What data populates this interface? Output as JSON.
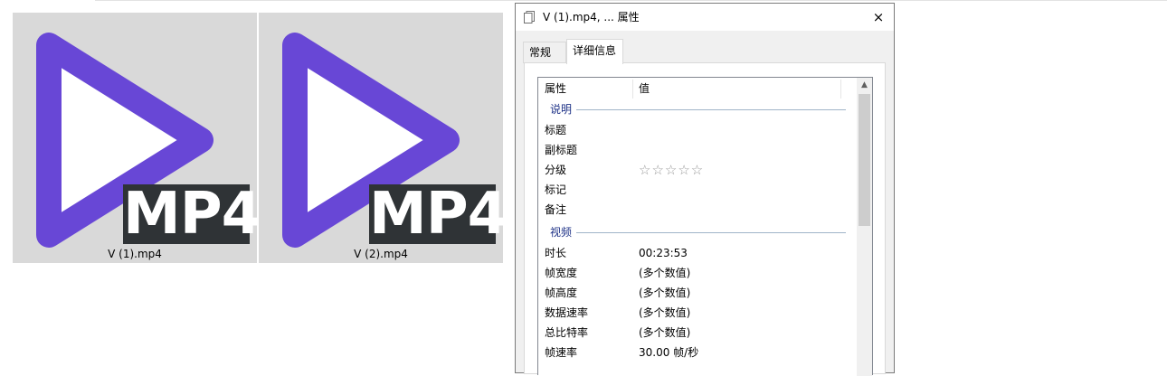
{
  "files": [
    {
      "name": "V (1).mp4",
      "badge": "MP4"
    },
    {
      "name": "V (2).mp4",
      "badge": "MP4"
    }
  ],
  "colors": {
    "play_icon": "#6847d6",
    "tile_bg": "#d9d9d9",
    "badge_bg": "#2f3336",
    "group_label": "#1e3287"
  },
  "dialog": {
    "title": "V (1).mp4, ... 属性",
    "close_icon": "×",
    "tabs": [
      {
        "label": "常规",
        "active": false
      },
      {
        "label": "详细信息",
        "active": true
      }
    ],
    "list": {
      "header": {
        "property": "属性",
        "value": "值"
      },
      "groups": [
        {
          "label": "说明",
          "rows": [
            {
              "name": "标题",
              "value": ""
            },
            {
              "name": "副标题",
              "value": ""
            },
            {
              "name": "分级",
              "value": "☆☆☆☆☆",
              "rating": 0
            },
            {
              "name": "标记",
              "value": ""
            },
            {
              "name": "备注",
              "value": ""
            }
          ]
        },
        {
          "label": "视频",
          "rows": [
            {
              "name": "时长",
              "value": "00:23:53"
            },
            {
              "name": "帧宽度",
              "value": "(多个数值)"
            },
            {
              "name": "帧高度",
              "value": "(多个数值)"
            },
            {
              "name": "数据速率",
              "value": "(多个数值)"
            },
            {
              "name": "总比特率",
              "value": "(多个数值)"
            },
            {
              "name": "帧速率",
              "value": "30.00 帧/秒"
            }
          ]
        }
      ]
    },
    "scroll_up_icon": "▲"
  }
}
